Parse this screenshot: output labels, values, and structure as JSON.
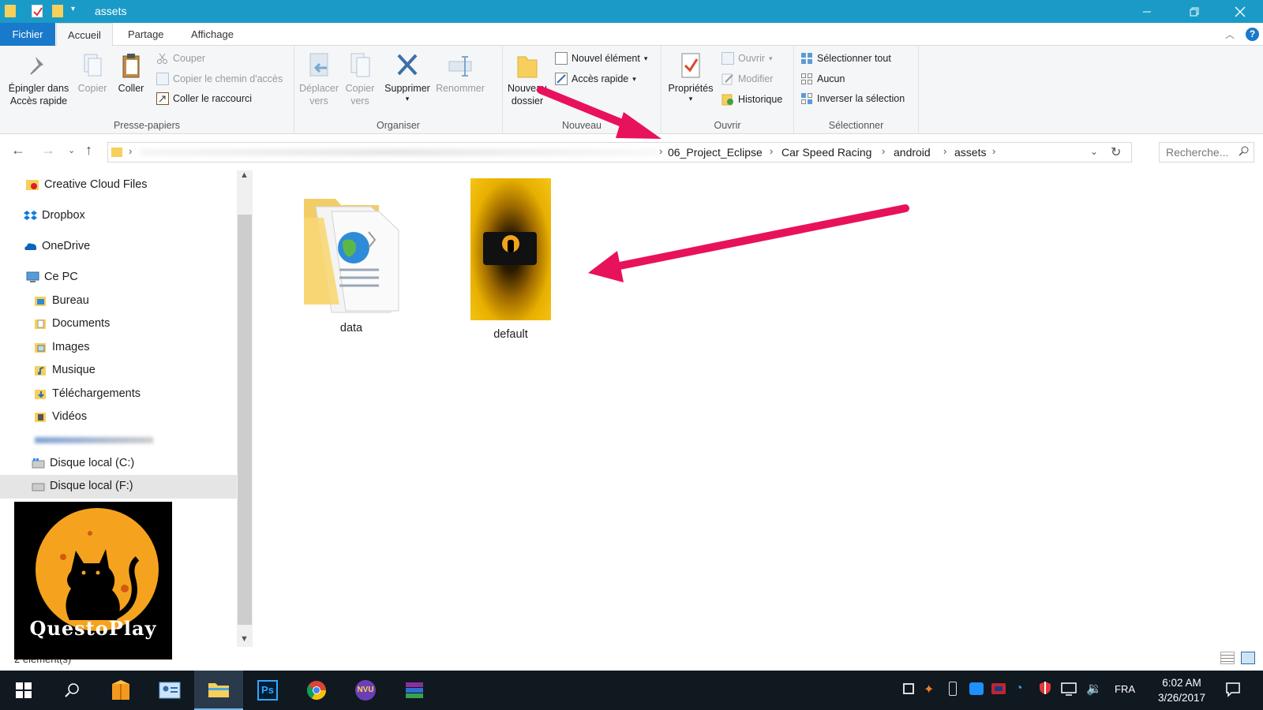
{
  "window": {
    "title": "assets",
    "minimize_icon": "minimize-icon",
    "maximize_icon": "restore-icon",
    "close_icon": "close-icon"
  },
  "tabs": [
    "Fichier",
    "Accueil",
    "Partage",
    "Affichage"
  ],
  "ribbon": {
    "presse_papiers": {
      "name": "Presse-papiers",
      "pin_label": "Épingler dans\nAccès rapide",
      "copy_label": "Copier",
      "paste_label": "Coller",
      "cut_label": "Couper",
      "copy_path_label": "Copier le chemin d'accès",
      "paste_shortcut_label": "Coller le raccourci"
    },
    "organiser": {
      "name": "Organiser",
      "move_label": "Déplacer\nvers",
      "copyto_label": "Copier\nvers",
      "delete_label": "Supprimer",
      "rename_label": "Renommer"
    },
    "nouveau": {
      "name": "Nouveau",
      "new_folder_label": "Nouveau\ndossier",
      "new_item_label": "Nouvel élément",
      "quick_access_label": "Accès rapide"
    },
    "ouvrir": {
      "name": "Ouvrir",
      "properties_label": "Propriétés",
      "open_label": "Ouvrir",
      "edit_label": "Modifier",
      "history_label": "Historique"
    },
    "selectionner": {
      "name": "Sélectionner",
      "select_all_label": "Sélectionner tout",
      "none_label": "Aucun",
      "invert_label": "Inverser la sélection"
    }
  },
  "address": {
    "crumbs": [
      "06_Project_Eclipse",
      "Car Speed Racing",
      "android",
      "assets"
    ],
    "search_placeholder": "Recherche..."
  },
  "nav": {
    "items": [
      "Creative Cloud Files",
      "Dropbox",
      "OneDrive",
      "Ce PC",
      "Bureau",
      "Documents",
      "Images",
      "Musique",
      "Téléchargements",
      "Vidéos",
      "Disque local (C:)",
      "Disque local (F:)"
    ]
  },
  "files": [
    {
      "name": "data",
      "type": "folder"
    },
    {
      "name": "default",
      "type": "image"
    }
  ],
  "status": {
    "count": "2 élément(s)"
  },
  "watermark": {
    "text": "QuestoPlay"
  },
  "taskbar": {
    "language": "FRA",
    "time": "6:02 AM",
    "date": "3/26/2017"
  },
  "colors": {
    "titlebar": "#1a9bc7",
    "file_tab": "#1979ca",
    "annotation_arrow": "#e8125c",
    "taskbar": "#101820"
  }
}
